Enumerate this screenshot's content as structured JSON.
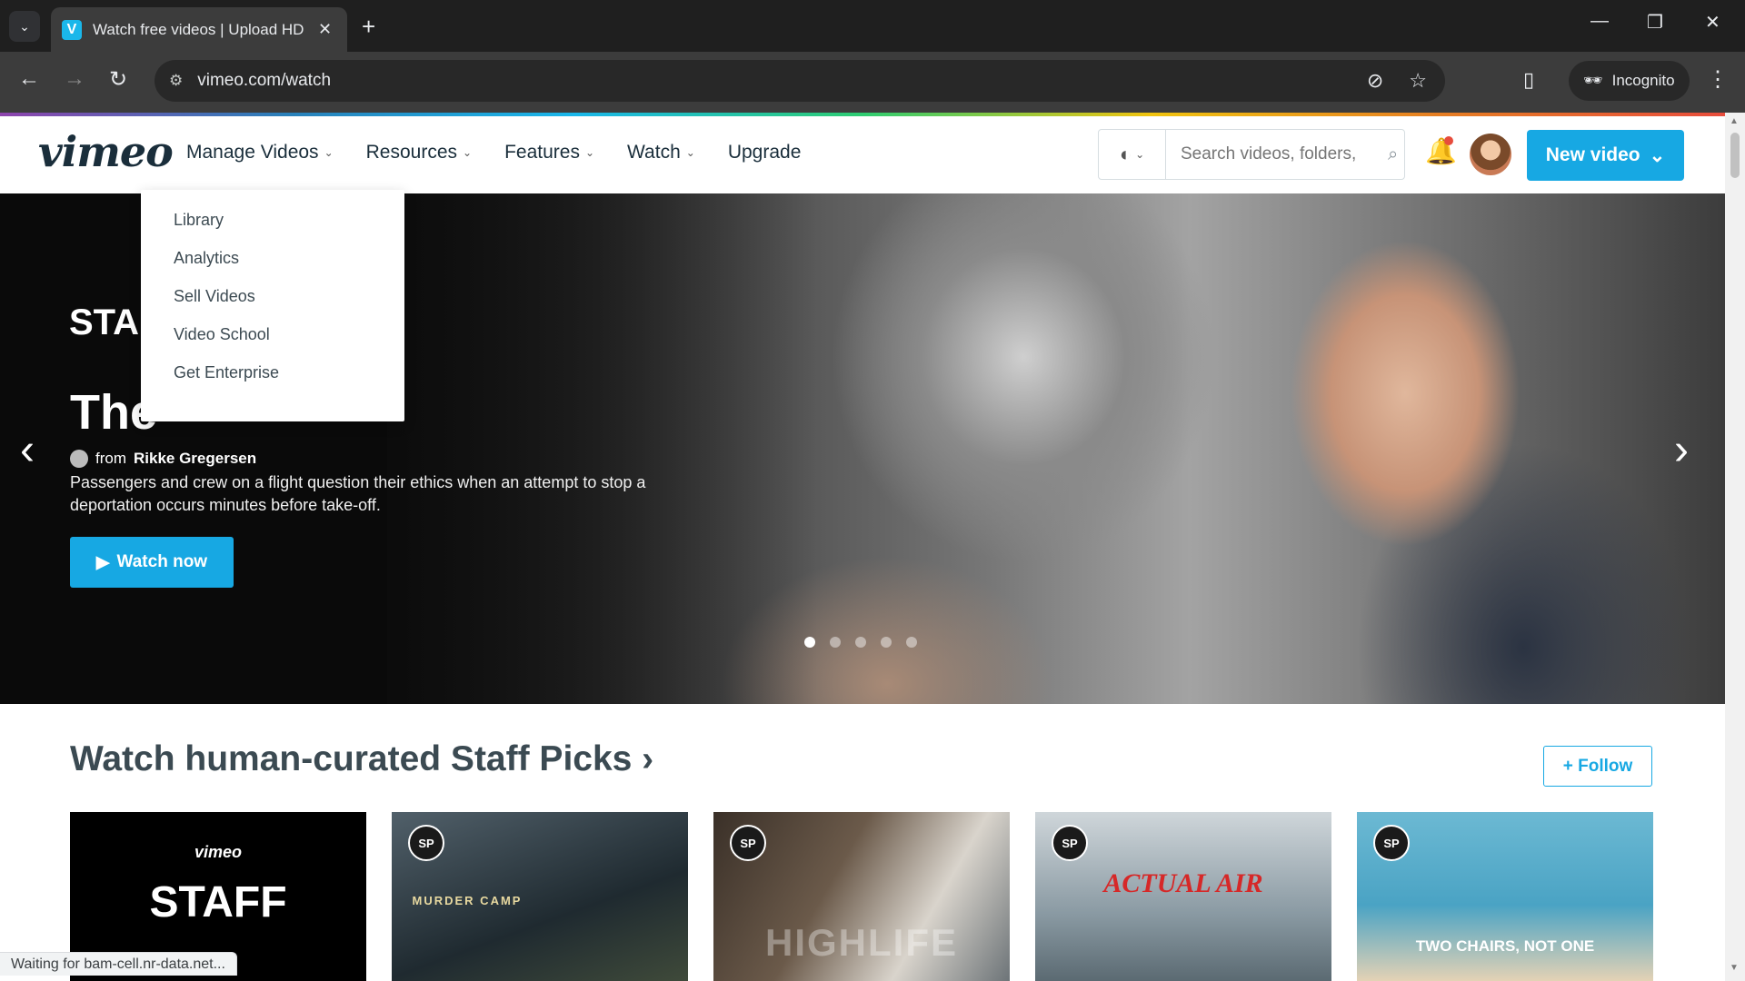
{
  "browser": {
    "tab_title": "Watch free videos | Upload HD",
    "tab_favicon": "V",
    "url": "vimeo.com/watch",
    "incognito_label": "Incognito",
    "status_text": "Waiting for bam-cell.nr-data.net...",
    "icons": [
      "tab-search-icon",
      "close-icon",
      "plus-icon",
      "back-icon",
      "forward-icon",
      "reload-icon",
      "site-info-icon",
      "eye-off-icon",
      "star-icon",
      "side-panel-icon",
      "incognito-icon",
      "menu-icon"
    ]
  },
  "header": {
    "logo": "vimeo",
    "nav": [
      {
        "label": "Manage Videos"
      },
      {
        "label": "Resources"
      },
      {
        "label": "Features"
      },
      {
        "label": "Watch"
      },
      {
        "label": "Upgrade"
      }
    ],
    "search_placeholder": "Search videos, folders,",
    "new_video_label": "New video"
  },
  "dropdown": {
    "items": [
      "Library",
      "Analytics",
      "Sell Videos",
      "Video School",
      "Get Enterprise"
    ]
  },
  "hero": {
    "logo_text": "STAFF",
    "title": "The",
    "by_prefix": "from",
    "author": "Rikke Gregersen",
    "description": "Passengers and crew on a flight question their ethics when an attempt to stop a deportation occurs minutes before take-off.",
    "watch_label": "Watch now",
    "slide_count": 5,
    "active_slide": 1
  },
  "staff_picks": {
    "title": "Watch human-curated Staff Picks ›",
    "follow_label": "+ Follow",
    "thumbnails": [
      {
        "text": "STAFF",
        "subtext": "vimeo",
        "badge": ""
      },
      {
        "text": "MURDER CAMP",
        "badge": "SP"
      },
      {
        "text": "HIGHLIFE",
        "badge": "SP"
      },
      {
        "text": "ACTUAL AIR",
        "badge": "SP"
      },
      {
        "text": "TWO CHAIRS, NOT ONE",
        "badge": "SP"
      }
    ]
  },
  "colors": {
    "accent": "#17a8e3",
    "text_dark": "#1a2e3b",
    "chrome_bg": "#1f1f1f"
  }
}
